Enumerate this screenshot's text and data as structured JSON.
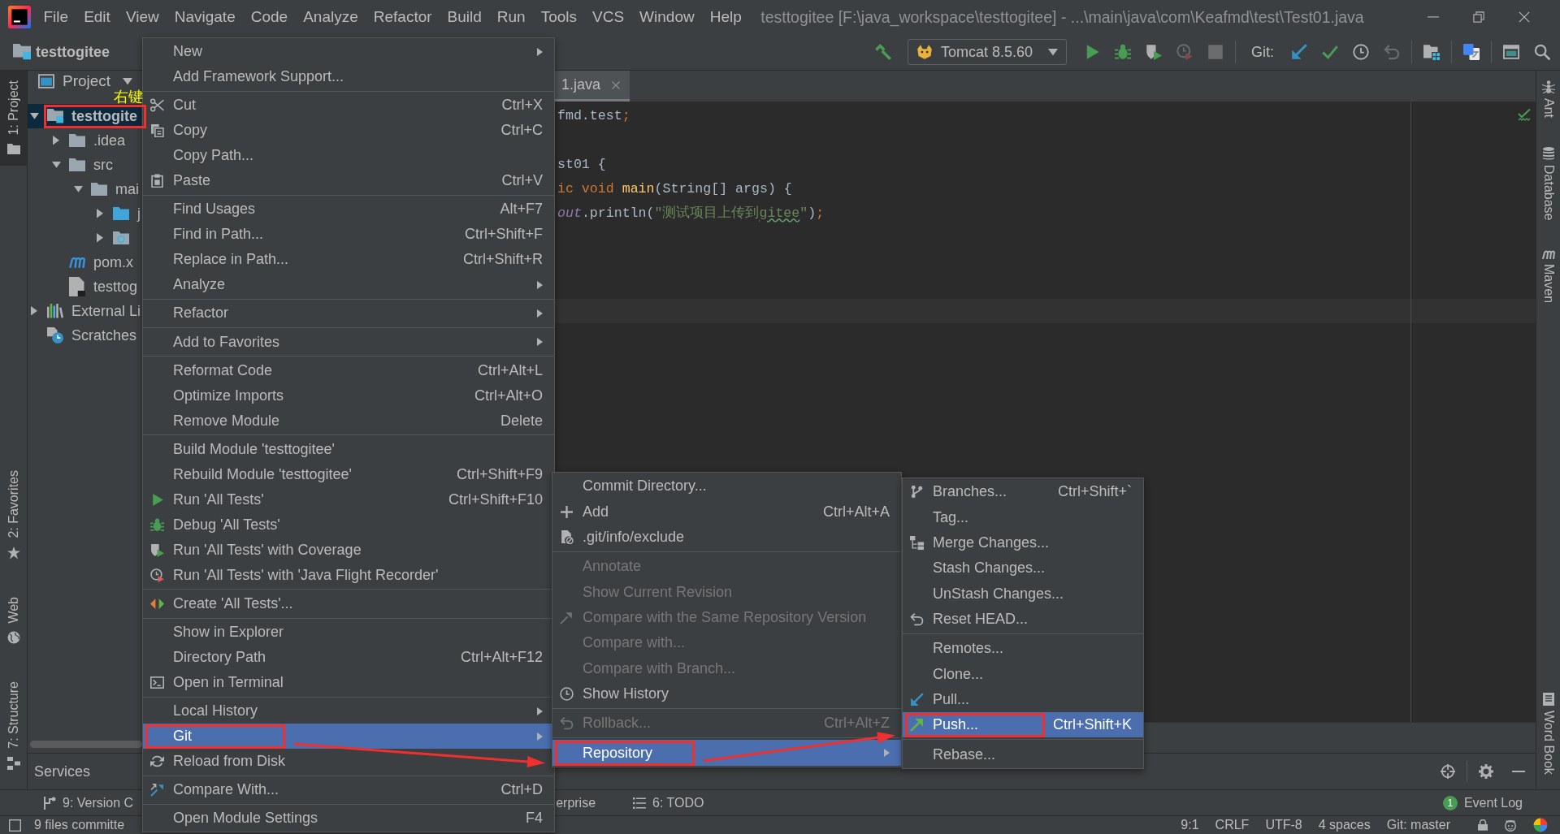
{
  "window": {
    "title": "testtogitee [F:\\java_workspace\\testtogitee] - ...\\main\\java\\com\\Keafmd\\test\\Test01.java"
  },
  "menu_bar": [
    "File",
    "Edit",
    "View",
    "Navigate",
    "Code",
    "Analyze",
    "Refactor",
    "Build",
    "Run",
    "Tools",
    "VCS",
    "Window",
    "Help"
  ],
  "navigation_bar": {
    "project": "testtogitee",
    "toolbar": [
      {
        "kind": "build",
        "disabled": false
      },
      {
        "kind": "config",
        "label": "Tomcat 8.5.60"
      },
      {
        "kind": "run",
        "disabled": false
      },
      {
        "kind": "debug",
        "disabled": false
      },
      {
        "kind": "coverage",
        "disabled": false
      },
      {
        "kind": "profiler",
        "disabled": true
      },
      {
        "kind": "stop",
        "disabled": true
      },
      {
        "kind": "separator"
      },
      {
        "kind": "label",
        "label": "Git:"
      },
      {
        "kind": "pull",
        "disabled": false
      },
      {
        "kind": "commit",
        "disabled": false
      },
      {
        "kind": "history",
        "disabled": false
      },
      {
        "kind": "rollback",
        "disabled": true
      },
      {
        "kind": "separator"
      },
      {
        "kind": "structure",
        "disabled": false
      },
      {
        "kind": "separator"
      },
      {
        "kind": "translate",
        "disabled": false
      },
      {
        "kind": "separator"
      },
      {
        "kind": "panel",
        "disabled": false
      },
      {
        "kind": "search",
        "disabled": false
      }
    ]
  },
  "left_strip": {
    "top": [
      {
        "label": "1: Project",
        "kind": "project",
        "selected": true
      }
    ],
    "bottom": [
      {
        "label": "2: Favorites",
        "kind": "favorites",
        "selected": false
      },
      {
        "label": "Web",
        "kind": "web",
        "selected": false
      },
      {
        "label": "7: Structure",
        "kind": "structure",
        "selected": false
      }
    ]
  },
  "project_panel": {
    "title": "Project",
    "tree": [
      {
        "label": "testtogite",
        "kind": "module",
        "expanded": true,
        "selected": true,
        "marked": true,
        "children": [
          {
            "label": ".idea",
            "kind": "folder",
            "expanded": false,
            "selected": false,
            "marked": false
          },
          {
            "label": "src",
            "kind": "folder",
            "expanded": true,
            "selected": false,
            "marked": false,
            "children": [
              {
                "label": "mai",
                "kind": "folder",
                "expanded": true,
                "selected": false,
                "marked": false,
                "children": [
                  {
                    "label": "j",
                    "kind": "source",
                    "expanded": false,
                    "selected": false,
                    "marked": false
                  },
                  {
                    "kind": "web",
                    "expanded": false,
                    "selected": false,
                    "marked": false
                  }
                ]
              }
            ]
          },
          {
            "label": "pom.x",
            "kind": "maven",
            "selected": false,
            "marked": false
          },
          {
            "label": "testtog",
            "kind": "iml",
            "selected": false,
            "marked": false
          }
        ]
      },
      {
        "label": "External Li",
        "kind": "libraries",
        "expanded": false,
        "selected": false,
        "marked": false
      },
      {
        "label": "Scratches",
        "kind": "scratches",
        "selected": false,
        "marked": false
      }
    ]
  },
  "annotation": {
    "note": "右键"
  },
  "editor": {
    "tabs": [
      {
        "label": "1.java",
        "selected": true
      }
    ],
    "lines": [
      {
        "kind": "code",
        "tokens": [
          {
            "text": "fmd.test",
            "kind": "plain"
          },
          {
            "text": ";",
            "kind": "keyword"
          }
        ]
      },
      {
        "kind": "blank"
      },
      {
        "kind": "code",
        "tokens": [
          {
            "text": "st01 {",
            "kind": "plain"
          }
        ]
      },
      {
        "kind": "code",
        "tokens": [
          {
            "text": "ic void ",
            "kind": "keyword"
          },
          {
            "text": "main",
            "kind": "method"
          },
          {
            "text": "(String[] args) {",
            "kind": "plain"
          }
        ]
      },
      {
        "kind": "code",
        "tokens": [
          {
            "text": "out",
            "kind": "field"
          },
          {
            "text": ".println(",
            "kind": "plain"
          },
          {
            "text": "\"测试项目上传到",
            "kind": "string"
          },
          {
            "text": "gitee",
            "kind": "typo"
          },
          {
            "text": "\"",
            "kind": "string"
          },
          {
            "text": ")",
            "kind": "plain"
          },
          {
            "text": ";",
            "kind": "keyword"
          }
        ]
      },
      {
        "kind": "blank"
      },
      {
        "kind": "blank"
      },
      {
        "kind": "blank"
      },
      {
        "kind": "caret"
      }
    ]
  },
  "right_strip": {
    "top": [
      {
        "label": "Ant",
        "kind": "ant",
        "selected": false
      },
      {
        "label": "Database",
        "kind": "database",
        "selected": false
      },
      {
        "label": "Maven",
        "kind": "maven",
        "selected": false
      }
    ],
    "bottom": [
      {
        "label": "Word Book",
        "kind": "book",
        "selected": false
      }
    ]
  },
  "services": {
    "title": "Services"
  },
  "bottom_tabs": [
    {
      "label": "9: Version C",
      "kind": "vcs",
      "selected": false
    },
    {
      "label": "erprise",
      "kind": "plain",
      "selected": false
    },
    {
      "label": "6: TODO",
      "kind": "todo",
      "selected": false
    }
  ],
  "event_log": {
    "label": "Event Log",
    "badge": "1"
  },
  "status_bar": {
    "message": "9 files committe",
    "items": [
      "9:1",
      "CRLF",
      "UTF-8",
      "4 spaces",
      "Git: master"
    ]
  },
  "context_menu": {
    "sections": [
      [
        {
          "label": "New",
          "kind": "submenu",
          "selected": false,
          "marked": false
        },
        {
          "label": "Add Framework Support...",
          "kind": "plain",
          "selected": false,
          "marked": false
        }
      ],
      [
        {
          "label": "Cut",
          "kind": "cut",
          "shortcut": "Ctrl+X",
          "selected": false,
          "marked": false
        },
        {
          "label": "Copy",
          "kind": "copy",
          "shortcut": "Ctrl+C",
          "selected": false,
          "marked": false
        },
        {
          "label": "Copy Path...",
          "kind": "plain",
          "selected": false,
          "marked": false
        },
        {
          "label": "Paste",
          "kind": "paste",
          "shortcut": "Ctrl+V",
          "selected": false,
          "marked": false
        }
      ],
      [
        {
          "label": "Find Usages",
          "kind": "plain",
          "shortcut": "Alt+F7",
          "selected": false,
          "marked": false
        },
        {
          "label": "Find in Path...",
          "kind": "plain",
          "shortcut": "Ctrl+Shift+F",
          "selected": false,
          "marked": false
        },
        {
          "label": "Replace in Path...",
          "kind": "plain",
          "shortcut": "Ctrl+Shift+R",
          "selected": false,
          "marked": false
        },
        {
          "label": "Analyze",
          "kind": "submenu",
          "selected": false,
          "marked": false
        }
      ],
      [
        {
          "label": "Refactor",
          "kind": "submenu",
          "selected": false,
          "marked": false
        }
      ],
      [
        {
          "label": "Add to Favorites",
          "kind": "submenu",
          "selected": false,
          "marked": false
        }
      ],
      [
        {
          "label": "Reformat Code",
          "kind": "plain",
          "shortcut": "Ctrl+Alt+L",
          "selected": false,
          "marked": false
        },
        {
          "label": "Optimize Imports",
          "kind": "plain",
          "shortcut": "Ctrl+Alt+O",
          "selected": false,
          "marked": false
        },
        {
          "label": "Remove Module",
          "kind": "plain",
          "shortcut": "Delete",
          "selected": false,
          "marked": false
        }
      ],
      [
        {
          "label": "Build Module 'testtogitee'",
          "kind": "plain",
          "selected": false,
          "marked": false
        },
        {
          "label": "Rebuild Module 'testtogitee'",
          "kind": "plain",
          "shortcut": "Ctrl+Shift+F9",
          "selected": false,
          "marked": false
        },
        {
          "label": "Run 'All Tests'",
          "kind": "run",
          "shortcut": "Ctrl+Shift+F10",
          "selected": false,
          "marked": false
        },
        {
          "label": "Debug 'All Tests'",
          "kind": "debug",
          "selected": false,
          "marked": false
        },
        {
          "label": "Run 'All Tests' with Coverage",
          "kind": "coverage",
          "selected": false,
          "marked": false
        },
        {
          "label": "Run 'All Tests' with 'Java Flight Recorder'",
          "kind": "profiler",
          "selected": false,
          "marked": false
        }
      ],
      [
        {
          "label": "Create 'All Tests'...",
          "kind": "create",
          "selected": false,
          "marked": false
        }
      ],
      [
        {
          "label": "Show in Explorer",
          "kind": "plain",
          "selected": false,
          "marked": false
        },
        {
          "label": "Directory Path",
          "kind": "plain",
          "shortcut": "Ctrl+Alt+F12",
          "selected": false,
          "marked": false
        },
        {
          "label": "Open in Terminal",
          "kind": "terminal",
          "selected": false,
          "marked": false
        }
      ],
      [
        {
          "label": "Local History",
          "kind": "submenu",
          "selected": false,
          "marked": false
        },
        {
          "label": "Git",
          "kind": "submenu",
          "selected": true,
          "marked": true,
          "open_menu": {
            "sections": [
              [
                {
                  "label": "Commit Directory...",
                  "kind": "plain",
                  "disabled": false,
                  "selected": false,
                  "marked": false
                },
                {
                  "label": "Add",
                  "kind": "add",
                  "shortcut": "Ctrl+Alt+A",
                  "disabled": false,
                  "selected": false,
                  "marked": false
                },
                {
                  "label": ".git/info/exclude",
                  "kind": "exclude",
                  "disabled": false,
                  "selected": false,
                  "marked": false
                }
              ],
              [
                {
                  "label": "Annotate",
                  "kind": "plain",
                  "disabled": true,
                  "selected": false,
                  "marked": false
                },
                {
                  "label": "Show Current Revision",
                  "kind": "plain",
                  "disabled": true,
                  "selected": false,
                  "marked": false
                },
                {
                  "label": "Compare with the Same Repository Version",
                  "kind": "diff",
                  "disabled": true,
                  "selected": false,
                  "marked": false
                },
                {
                  "label": "Compare with...",
                  "kind": "plain",
                  "disabled": true,
                  "selected": false,
                  "marked": false
                },
                {
                  "label": "Compare with Branch...",
                  "kind": "plain",
                  "disabled": true,
                  "selected": false,
                  "marked": false
                },
                {
                  "label": "Show History",
                  "kind": "history",
                  "disabled": false,
                  "selected": false,
                  "marked": false
                }
              ],
              [
                {
                  "label": "Rollback...",
                  "kind": "rollback",
                  "shortcut": "Ctrl+Alt+Z",
                  "disabled": true,
                  "selected": false,
                  "marked": false
                }
              ],
              [
                {
                  "label": "Repository",
                  "kind": "submenu",
                  "disabled": false,
                  "selected": true,
                  "marked": true,
                  "open_menu": {
                    "sections": [
                      [
                        {
                          "label": "Branches...",
                          "kind": "branches",
                          "shortcut": "Ctrl+Shift+`",
                          "selected": false,
                          "marked": false
                        },
                        {
                          "label": "Tag...",
                          "kind": "plain",
                          "selected": false,
                          "marked": false
                        },
                        {
                          "label": "Merge Changes...",
                          "kind": "merge",
                          "selected": false,
                          "marked": false
                        },
                        {
                          "label": "Stash Changes...",
                          "kind": "plain",
                          "selected": false,
                          "marked": false
                        },
                        {
                          "label": "UnStash Changes...",
                          "kind": "plain",
                          "selected": false,
                          "marked": false
                        },
                        {
                          "label": "Reset HEAD...",
                          "kind": "reset",
                          "selected": false,
                          "marked": false
                        }
                      ],
                      [
                        {
                          "label": "Remotes...",
                          "kind": "plain",
                          "selected": false,
                          "marked": false
                        },
                        {
                          "label": "Clone...",
                          "kind": "plain",
                          "selected": false,
                          "marked": false
                        },
                        {
                          "label": "Pull...",
                          "kind": "pull",
                          "selected": false,
                          "marked": false
                        },
                        {
                          "label": "Push...",
                          "kind": "push",
                          "shortcut": "Ctrl+Shift+K",
                          "selected": true,
                          "marked": true
                        }
                      ],
                      [
                        {
                          "label": "Rebase...",
                          "kind": "plain",
                          "selected": false,
                          "marked": false
                        }
                      ]
                    ]
                  }
                }
              ]
            ]
          }
        },
        {
          "label": "Reload from Disk",
          "kind": "reload",
          "selected": false,
          "marked": false
        }
      ],
      [
        {
          "label": "Compare With...",
          "kind": "compare",
          "shortcut": "Ctrl+D",
          "selected": false,
          "marked": false
        }
      ],
      [
        {
          "label": "Open Module Settings",
          "kind": "plain",
          "shortcut": "F4",
          "selected": false,
          "marked": false
        }
      ]
    ]
  }
}
